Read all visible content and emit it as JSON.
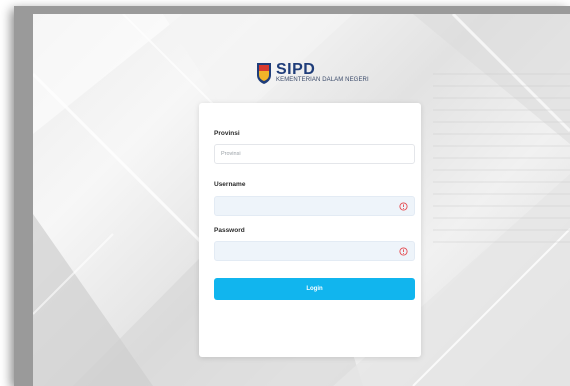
{
  "brand": {
    "name": "SIPD",
    "subtitle": "KEMENTERIAN DALAM NEGERI"
  },
  "form": {
    "provinsi": {
      "label": "Provinsi",
      "placeholder": "Provinsi"
    },
    "username": {
      "label": "Username",
      "value": ""
    },
    "password": {
      "label": "Password",
      "value": ""
    },
    "login_label": "Login"
  },
  "colors": {
    "accent": "#11b5ee",
    "brand_blue": "#1f3d7a",
    "warning": "#e5484d"
  }
}
